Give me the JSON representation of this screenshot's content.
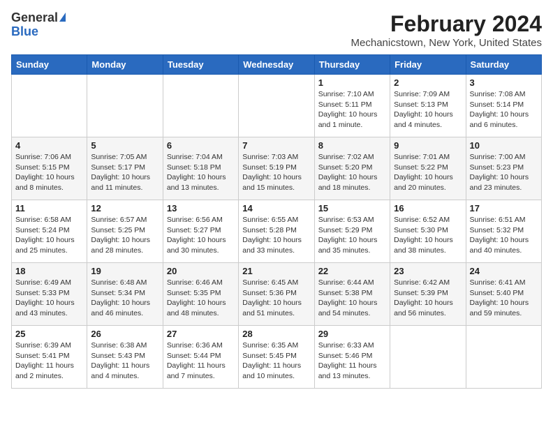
{
  "header": {
    "logo_general": "General",
    "logo_blue": "Blue",
    "title": "February 2024",
    "subtitle": "Mechanicstown, New York, United States"
  },
  "weekdays": [
    "Sunday",
    "Monday",
    "Tuesday",
    "Wednesday",
    "Thursday",
    "Friday",
    "Saturday"
  ],
  "weeks": [
    [
      {
        "day": "",
        "info": ""
      },
      {
        "day": "",
        "info": ""
      },
      {
        "day": "",
        "info": ""
      },
      {
        "day": "",
        "info": ""
      },
      {
        "day": "1",
        "info": "Sunrise: 7:10 AM\nSunset: 5:11 PM\nDaylight: 10 hours\nand 1 minute."
      },
      {
        "day": "2",
        "info": "Sunrise: 7:09 AM\nSunset: 5:13 PM\nDaylight: 10 hours\nand 4 minutes."
      },
      {
        "day": "3",
        "info": "Sunrise: 7:08 AM\nSunset: 5:14 PM\nDaylight: 10 hours\nand 6 minutes."
      }
    ],
    [
      {
        "day": "4",
        "info": "Sunrise: 7:06 AM\nSunset: 5:15 PM\nDaylight: 10 hours\nand 8 minutes."
      },
      {
        "day": "5",
        "info": "Sunrise: 7:05 AM\nSunset: 5:17 PM\nDaylight: 10 hours\nand 11 minutes."
      },
      {
        "day": "6",
        "info": "Sunrise: 7:04 AM\nSunset: 5:18 PM\nDaylight: 10 hours\nand 13 minutes."
      },
      {
        "day": "7",
        "info": "Sunrise: 7:03 AM\nSunset: 5:19 PM\nDaylight: 10 hours\nand 15 minutes."
      },
      {
        "day": "8",
        "info": "Sunrise: 7:02 AM\nSunset: 5:20 PM\nDaylight: 10 hours\nand 18 minutes."
      },
      {
        "day": "9",
        "info": "Sunrise: 7:01 AM\nSunset: 5:22 PM\nDaylight: 10 hours\nand 20 minutes."
      },
      {
        "day": "10",
        "info": "Sunrise: 7:00 AM\nSunset: 5:23 PM\nDaylight: 10 hours\nand 23 minutes."
      }
    ],
    [
      {
        "day": "11",
        "info": "Sunrise: 6:58 AM\nSunset: 5:24 PM\nDaylight: 10 hours\nand 25 minutes."
      },
      {
        "day": "12",
        "info": "Sunrise: 6:57 AM\nSunset: 5:25 PM\nDaylight: 10 hours\nand 28 minutes."
      },
      {
        "day": "13",
        "info": "Sunrise: 6:56 AM\nSunset: 5:27 PM\nDaylight: 10 hours\nand 30 minutes."
      },
      {
        "day": "14",
        "info": "Sunrise: 6:55 AM\nSunset: 5:28 PM\nDaylight: 10 hours\nand 33 minutes."
      },
      {
        "day": "15",
        "info": "Sunrise: 6:53 AM\nSunset: 5:29 PM\nDaylight: 10 hours\nand 35 minutes."
      },
      {
        "day": "16",
        "info": "Sunrise: 6:52 AM\nSunset: 5:30 PM\nDaylight: 10 hours\nand 38 minutes."
      },
      {
        "day": "17",
        "info": "Sunrise: 6:51 AM\nSunset: 5:32 PM\nDaylight: 10 hours\nand 40 minutes."
      }
    ],
    [
      {
        "day": "18",
        "info": "Sunrise: 6:49 AM\nSunset: 5:33 PM\nDaylight: 10 hours\nand 43 minutes."
      },
      {
        "day": "19",
        "info": "Sunrise: 6:48 AM\nSunset: 5:34 PM\nDaylight: 10 hours\nand 46 minutes."
      },
      {
        "day": "20",
        "info": "Sunrise: 6:46 AM\nSunset: 5:35 PM\nDaylight: 10 hours\nand 48 minutes."
      },
      {
        "day": "21",
        "info": "Sunrise: 6:45 AM\nSunset: 5:36 PM\nDaylight: 10 hours\nand 51 minutes."
      },
      {
        "day": "22",
        "info": "Sunrise: 6:44 AM\nSunset: 5:38 PM\nDaylight: 10 hours\nand 54 minutes."
      },
      {
        "day": "23",
        "info": "Sunrise: 6:42 AM\nSunset: 5:39 PM\nDaylight: 10 hours\nand 56 minutes."
      },
      {
        "day": "24",
        "info": "Sunrise: 6:41 AM\nSunset: 5:40 PM\nDaylight: 10 hours\nand 59 minutes."
      }
    ],
    [
      {
        "day": "25",
        "info": "Sunrise: 6:39 AM\nSunset: 5:41 PM\nDaylight: 11 hours\nand 2 minutes."
      },
      {
        "day": "26",
        "info": "Sunrise: 6:38 AM\nSunset: 5:43 PM\nDaylight: 11 hours\nand 4 minutes."
      },
      {
        "day": "27",
        "info": "Sunrise: 6:36 AM\nSunset: 5:44 PM\nDaylight: 11 hours\nand 7 minutes."
      },
      {
        "day": "28",
        "info": "Sunrise: 6:35 AM\nSunset: 5:45 PM\nDaylight: 11 hours\nand 10 minutes."
      },
      {
        "day": "29",
        "info": "Sunrise: 6:33 AM\nSunset: 5:46 PM\nDaylight: 11 hours\nand 13 minutes."
      },
      {
        "day": "",
        "info": ""
      },
      {
        "day": "",
        "info": ""
      }
    ]
  ]
}
